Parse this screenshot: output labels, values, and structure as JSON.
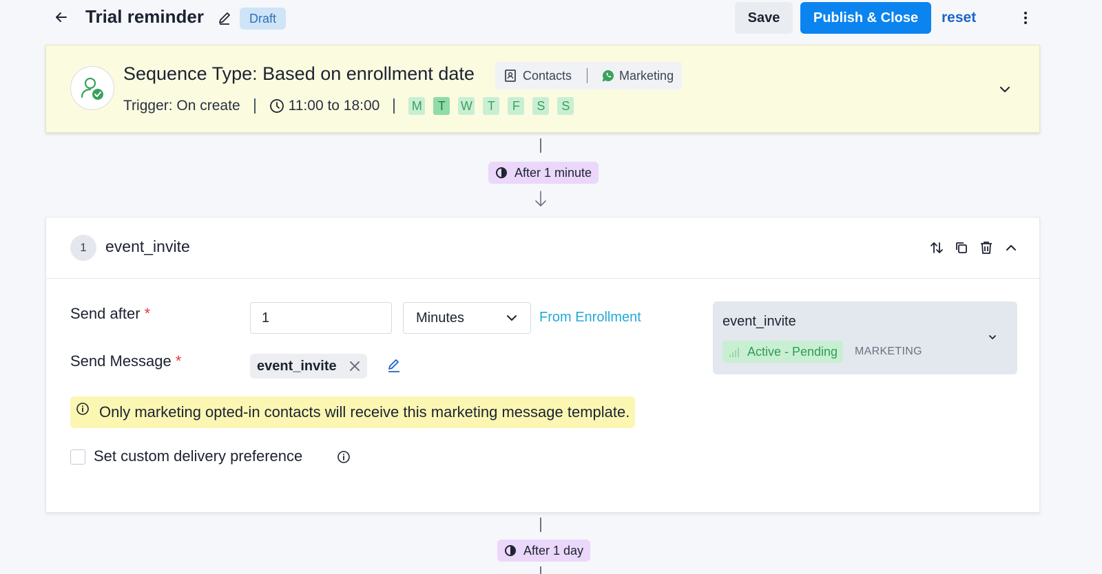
{
  "header": {
    "title": "Trial reminder",
    "status_badge": "Draft",
    "save_label": "Save",
    "publish_label": "Publish & Close",
    "reset_label": "reset"
  },
  "sequence": {
    "type_label": "Sequence Type: Based on enrollment date",
    "source_label": "Contacts",
    "channel_label": "Marketing",
    "trigger_label": "Trigger: On create",
    "time_window": "11:00 to 18:00",
    "days": [
      {
        "label": "M",
        "active": false
      },
      {
        "label": "T",
        "active": true
      },
      {
        "label": "W",
        "active": false
      },
      {
        "label": "T",
        "active": false
      },
      {
        "label": "F",
        "active": false
      },
      {
        "label": "S",
        "active": false
      },
      {
        "label": "S",
        "active": false
      }
    ]
  },
  "delays": {
    "first": "After 1 minute",
    "second": "After 1 day"
  },
  "step": {
    "number": "1",
    "name": "event_invite",
    "send_after_label": "Send after",
    "send_after_value": "1",
    "unit_value": "Minutes",
    "from_label": "From Enrollment",
    "send_message_label": "Send Message",
    "message_chip": "event_invite",
    "template": {
      "name": "event_invite",
      "status": "Active - Pending",
      "category": "MARKETING"
    },
    "warning": "Only marketing opted-in contacts will receive this marketing message template.",
    "custom_delivery_label": "Set custom delivery preference"
  },
  "colors": {
    "primary": "#0b84ef",
    "seq_card_bg": "#fbfbe0",
    "delay_pill_bg": "#ead7f9",
    "status_green": "#2f9c55",
    "warning_bg": "#fbf7b3"
  }
}
